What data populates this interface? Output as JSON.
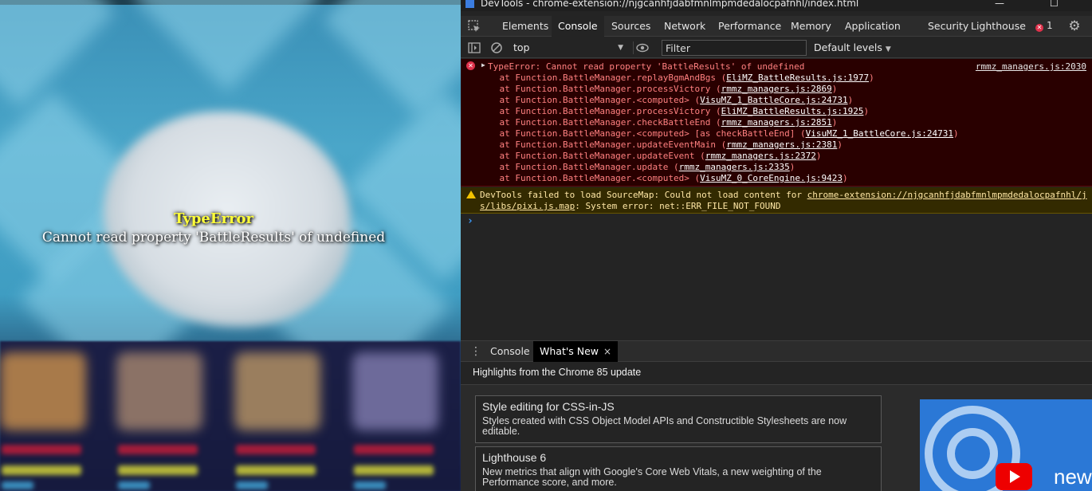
{
  "window": {
    "title": "DevTools - chrome-extension://njgcanhfjdabfmnlmpmdedalocpafnhl/index.html"
  },
  "game": {
    "error_title": "TypeError",
    "error_message": "Cannot read property 'BattleResults' of undefined"
  },
  "tabs": {
    "elements": "Elements",
    "console": "Console",
    "sources": "Sources",
    "network": "Network",
    "performance": "Performance",
    "memory": "Memory",
    "application": "Application",
    "security": "Security",
    "lighthouse": "Lighthouse",
    "error_count": "1"
  },
  "toolbar": {
    "context": "top",
    "filter_placeholder": "Filter",
    "levels": "Default levels"
  },
  "console": {
    "error": {
      "message": "TypeError: Cannot read property 'BattleResults' of undefined",
      "source": "rmmz_managers.js:2030",
      "stack": [
        {
          "prefix": "    at Function.BattleManager.replayBgmAndBgs (",
          "link": "EliMZ_BattleResults.js:1977",
          "suffix": ")"
        },
        {
          "prefix": "    at Function.BattleManager.processVictory (",
          "link": "rmmz_managers.js:2869",
          "suffix": ")"
        },
        {
          "prefix": "    at Function.BattleManager.<computed> (",
          "link": "VisuMZ_1_BattleCore.js:24731",
          "suffix": ")"
        },
        {
          "prefix": "    at Function.BattleManager.processVictory (",
          "link": "EliMZ_BattleResults.js:1925",
          "suffix": ")"
        },
        {
          "prefix": "    at Function.BattleManager.checkBattleEnd (",
          "link": "rmmz_managers.js:2851",
          "suffix": ")"
        },
        {
          "prefix": "    at Function.BattleManager.<computed> [as checkBattleEnd] (",
          "link": "VisuMZ_1_BattleCore.js:24731",
          "suffix": ")"
        },
        {
          "prefix": "    at Function.BattleManager.updateEventMain (",
          "link": "rmmz_managers.js:2381",
          "suffix": ")"
        },
        {
          "prefix": "    at Function.BattleManager.updateEvent (",
          "link": "rmmz_managers.js:2372",
          "suffix": ")"
        },
        {
          "prefix": "    at Function.BattleManager.update (",
          "link": "rmmz_managers.js:2335",
          "suffix": ")"
        },
        {
          "prefix": "    at Function.BattleManager.<computed> (",
          "link": "VisuMZ_0_CoreEngine.js:9423",
          "suffix": ")"
        }
      ]
    },
    "warning": {
      "line1_text": "DevTools failed to load SourceMap: Could not load content for ",
      "line1_link": "chrome-extension://njgcanhfjdabfmnlmpmdedalocpafnhl/j",
      "line2_link": "s/libs/pixi.js.map",
      "line2_text": ": System error: net::ERR_FILE_NOT_FOUND"
    },
    "prompt": "›"
  },
  "drawer": {
    "tab_console": "Console",
    "tab_whats_new": "What's New",
    "close": "×",
    "heading": "Highlights from the Chrome 85 update",
    "cards": [
      {
        "title": "Style editing for CSS-in-JS",
        "desc": "Styles created with CSS Object Model APIs and Constructible Stylesheets are now editable."
      },
      {
        "title": "Lighthouse 6",
        "desc": "New metrics that align with Google's Core Web Vitals, a new weighting of the Performance score, and more."
      }
    ],
    "video_text": "new"
  },
  "colors": {
    "error_bg": "#290000",
    "error_text": "#ff8080",
    "warning_bg": "#332a00",
    "accent_blue": "#3b9cff",
    "game_error_title": "#ffff3a"
  }
}
